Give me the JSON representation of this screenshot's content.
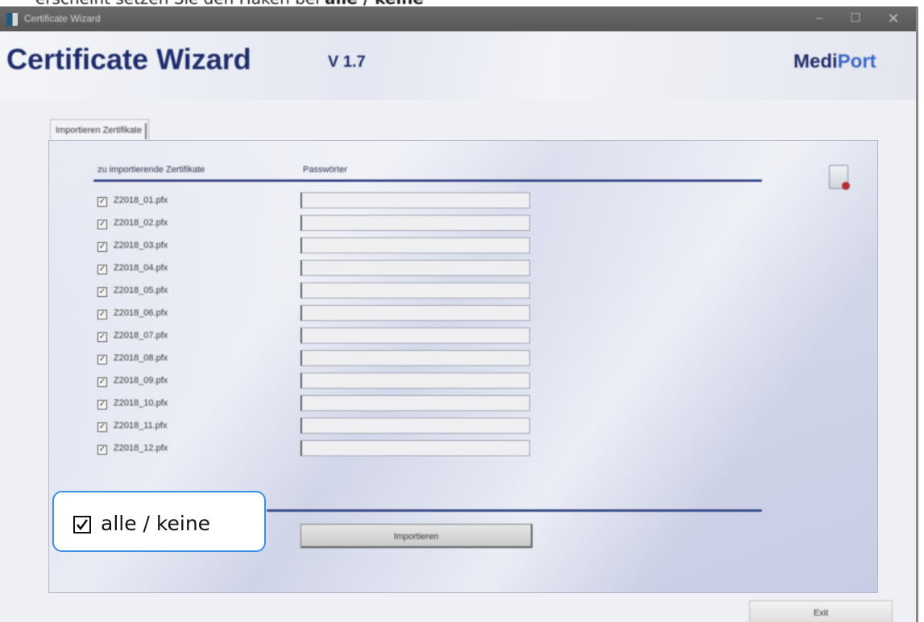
{
  "caption": {
    "text_plain": "erscheint setzen Sie den Haken bei ",
    "text_bold": "alle / keine"
  },
  "window": {
    "title": "Certificate Wizard",
    "controls": {
      "minimize": "–",
      "maximize": "☐",
      "close": "✕"
    }
  },
  "header": {
    "title": "Certificate Wizard",
    "version": "V 1.7",
    "brand_part1": "Medi",
    "brand_part2": "Port"
  },
  "tab": {
    "label": "Importieren Zertifikate"
  },
  "table": {
    "col_certificates": "zu importierende Zertifikate",
    "col_passwords": "Passwörter",
    "rows": [
      {
        "checked": true,
        "file": "Z2018_01.pfx",
        "password": ""
      },
      {
        "checked": true,
        "file": "Z2018_02.pfx",
        "password": ""
      },
      {
        "checked": true,
        "file": "Z2018_03.pfx",
        "password": ""
      },
      {
        "checked": true,
        "file": "Z2018_04.pfx",
        "password": ""
      },
      {
        "checked": true,
        "file": "Z2018_05.pfx",
        "password": ""
      },
      {
        "checked": true,
        "file": "Z2018_06.pfx",
        "password": ""
      },
      {
        "checked": true,
        "file": "Z2018_07.pfx",
        "password": ""
      },
      {
        "checked": true,
        "file": "Z2018_08.pfx",
        "password": ""
      },
      {
        "checked": true,
        "file": "Z2018_09.pfx",
        "password": ""
      },
      {
        "checked": true,
        "file": "Z2018_10.pfx",
        "password": ""
      },
      {
        "checked": true,
        "file": "Z2018_11.pfx",
        "password": ""
      },
      {
        "checked": true,
        "file": "Z2018_12.pfx",
        "password": ""
      }
    ]
  },
  "select_all": {
    "label": "alle / keine",
    "checked": true
  },
  "buttons": {
    "import": "Importieren",
    "exit": "Exit"
  },
  "colors": {
    "accent": "#3a4a8a",
    "brand_highlight": "#3d64c6",
    "callout_border": "#3a8fe8"
  }
}
